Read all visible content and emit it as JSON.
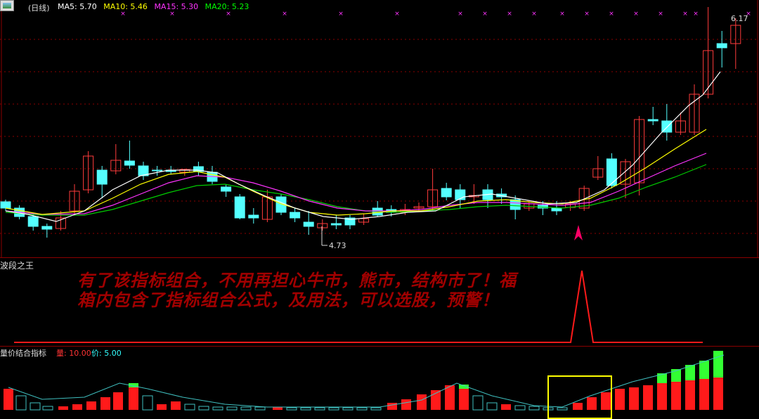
{
  "main": {
    "title": "(日线)",
    "ma_labels": [
      {
        "text": "MA5: 5.70",
        "color": "#ffffff"
      },
      {
        "text": "MA10: 5.46",
        "color": "#ffff00"
      },
      {
        "text": "MA15: 5.30",
        "color": "#ff33ff"
      },
      {
        "text": "MA20: 5.23",
        "color": "#00ff00"
      }
    ],
    "high_label": "6.17",
    "low_label": "4.73"
  },
  "indicator1": {
    "title": "波段之王",
    "note": "有了该指标组合，不用再担心牛市，熊市，结构市了！福箱内包含了指标组合公式，及用法，可以选股，预警！"
  },
  "indicator2": {
    "title": "量价结合指标",
    "param1": "量: 10.00",
    "param2": "价: 5.00"
  },
  "colors": {
    "up": "#ff3b3b",
    "down": "#54ffff",
    "grid": "#8b0000",
    "signal": "#ff0066",
    "highlight": "#ffff00"
  }
}
